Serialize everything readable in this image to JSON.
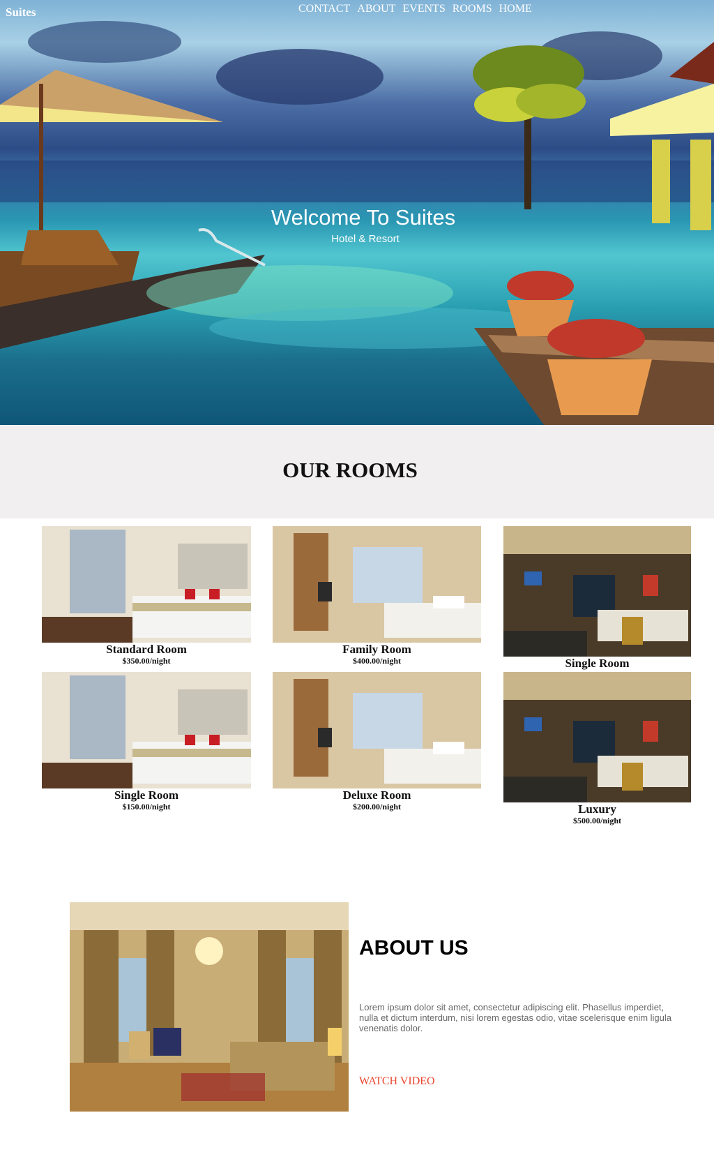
{
  "header": {
    "brand": "Suites",
    "nav": [
      "CONTACT",
      "ABOUT",
      "EVENTS",
      "ROOMS",
      "HOME"
    ]
  },
  "hero": {
    "title": "Welcome To Suites",
    "subtitle": "Hotel & Resort"
  },
  "rooms": {
    "title": "OUR ROOMS",
    "items": [
      {
        "name": "Standard Room",
        "price": "$350.00/night",
        "photo": "bright-bedroom-photo"
      },
      {
        "name": "Family Room",
        "price": "$400.00/night",
        "photo": "city-view-bedroom-photo"
      },
      {
        "name": "Single Room",
        "price": "",
        "photo": "dim-bedroom-photo"
      },
      {
        "name": "Single Room",
        "price": "$150.00/night",
        "photo": "bright-bedroom-photo"
      },
      {
        "name": "Deluxe Room",
        "price": "$200.00/night",
        "photo": "city-view-bedroom-photo"
      },
      {
        "name": "Luxury",
        "price": "$500.00/night",
        "photo": "dim-bedroom-photo"
      }
    ]
  },
  "about": {
    "title": "ABOUT US",
    "text": "Lorem ipsum dolor sit amet, consectetur adipiscing elit. Phasellus imperdiet, nulla et dictum interdum, nisi lorem egestas odio, vitae scelerisque enim ligula venenatis dolor.",
    "link": "WATCH VIDEO"
  },
  "colors": {
    "accent_link": "#e8452c",
    "band_bg": "#f1efef"
  }
}
